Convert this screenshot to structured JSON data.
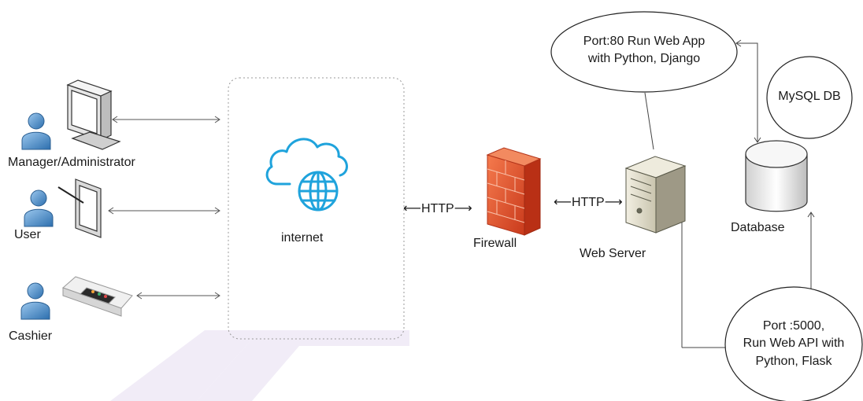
{
  "labels": {
    "manager": "Manager/Administrator",
    "user": "User",
    "cashier": "Cashier",
    "internet": "internet",
    "http_left": "⟵HTTP⟶",
    "firewall": "Firewall",
    "http_right": "⟵HTTP⟶",
    "web_server": "Web Server",
    "database": "Database"
  },
  "bubbles": {
    "web_app": [
      "Port:80 Run Web App",
      "with Python, Django"
    ],
    "mysql": [
      "MySQL DB"
    ],
    "web_api": [
      "Port :5000,",
      "Run Web API with",
      "Python, Flask"
    ]
  },
  "icons": {
    "person": "person-icon",
    "monitor": "monitor-icon",
    "tablet": "tablet-icon",
    "pos": "pos-terminal-icon",
    "cloud": "cloud-globe-icon",
    "firewall": "firewall-brick-icon",
    "server": "server-tower-icon",
    "database": "database-cylinder-icon"
  },
  "colors": {
    "person_fill": "#3f86c6",
    "cloud_stroke": "#1fa3dc",
    "firewall_red": "#e8532f",
    "watermark": "#efe9f6"
  }
}
